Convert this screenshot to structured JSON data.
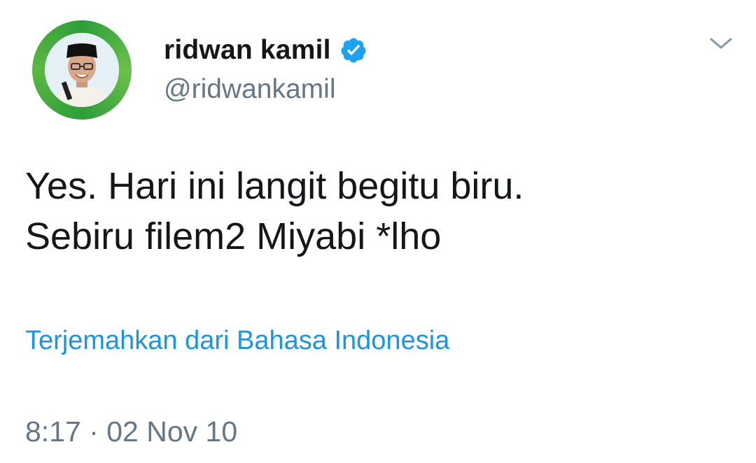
{
  "tweet": {
    "author": {
      "display_name": "ridwan kamil",
      "handle": "@ridwankamil",
      "verified": true,
      "verified_icon": "verified-badge-icon"
    },
    "menu_icon": "chevron-down-icon",
    "text_line1": "Yes. Hari ini langit begitu biru.",
    "text_line2": "Sebiru filem2 Miyabi *lho",
    "translate_label": "Terjemahkan dari Bahasa Indonesia",
    "timestamp": "8:17 · 02 Nov 10"
  },
  "colors": {
    "text_primary": "#14171a",
    "text_secondary": "#657786",
    "link": "#1b95e0",
    "verified": "#1da1f2",
    "avatar_ring": "#3aa640"
  }
}
